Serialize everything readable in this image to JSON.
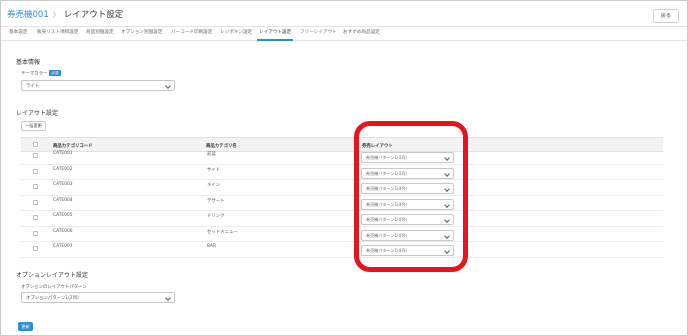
{
  "breadcrumb": {
    "parent": "券売機001",
    "separator": "〉",
    "current": "レイアウト設定"
  },
  "header": {
    "back_label": "戻る"
  },
  "tabs": [
    {
      "label": "基本設定"
    },
    {
      "label": "販売リスト項目設定"
    },
    {
      "label": "商品別個設定"
    },
    {
      "label": "オプション別個設定"
    },
    {
      "label": "バーコード印刷設定"
    },
    {
      "label": "レジポキン設定"
    },
    {
      "label": "レイアウト設定",
      "active": true
    },
    {
      "label": "フリーレイアウト"
    },
    {
      "label": "おすすめ商品設定"
    }
  ],
  "basic_info": {
    "title": "基本情報",
    "theme_label": "テーマカラー",
    "required_badge": "必須",
    "theme_value": "ライト"
  },
  "layout_settings": {
    "title": "レイアウト設定",
    "bulk_change_label": "一括変更",
    "columns": {
      "code": "商品カテゴリコード",
      "name": "商品カテゴリ名",
      "layout": "券売レイアウト"
    },
    "rows": [
      {
        "code": "CATE001",
        "name": "前菜",
        "layout": "券売機パターン1(4列)"
      },
      {
        "code": "CATE002",
        "name": "サイド",
        "layout": "券売機パターン1(4列)"
      },
      {
        "code": "CATE003",
        "name": "メイン",
        "layout": "券売機パターン1(4列)"
      },
      {
        "code": "CATE004",
        "name": "デザート",
        "layout": "券売機パターン1(4列)"
      },
      {
        "code": "CATE005",
        "name": "ドリンク",
        "layout": "券売機パターン1(4列)"
      },
      {
        "code": "CATE006",
        "name": "セットメニュー",
        "layout": "券売機パターン1(4列)"
      },
      {
        "code": "CATE007",
        "name": "BAR",
        "layout": "券売機パターン1(4列)"
      }
    ]
  },
  "option_layout": {
    "title": "オプションレイアウト設定",
    "pattern_label": "オプションのレイアウトパターン",
    "pattern_value": "オプションパターン1(2列)"
  },
  "footer": {
    "save_label": "更新"
  },
  "colors": {
    "accent": "#2a8fd6",
    "highlight": "#e8141b"
  }
}
